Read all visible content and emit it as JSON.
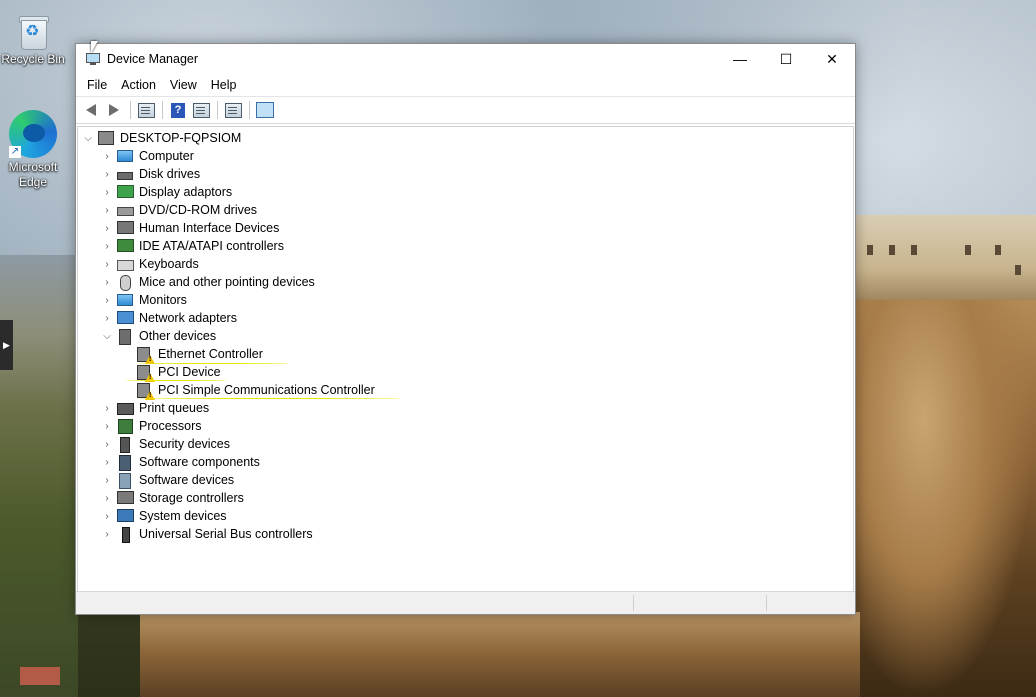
{
  "desktop": {
    "icons": [
      {
        "label": "Recycle Bin",
        "icon": "recycle-bin-icon"
      },
      {
        "label": "Microsoft Edge",
        "icon": "edge-icon"
      }
    ]
  },
  "window": {
    "title": "Device Manager",
    "controls": {
      "minimize": "—",
      "maximize": "☐",
      "close": "✕"
    },
    "menu": [
      "File",
      "Action",
      "View",
      "Help"
    ],
    "toolbar": [
      "back-icon",
      "forward-icon",
      "properties-icon",
      "help-icon",
      "show-hide-icon",
      "update-driver-icon",
      "scan-hardware-icon"
    ]
  },
  "tree": {
    "root": "DESKTOP-FQPSIOM",
    "categories": [
      {
        "label": "Computer",
        "icon": "computer-icon",
        "expanded": false
      },
      {
        "label": "Disk drives",
        "icon": "disk-drive-icon",
        "expanded": false
      },
      {
        "label": "Display adaptors",
        "icon": "display-adapter-icon",
        "expanded": false
      },
      {
        "label": "DVD/CD-ROM drives",
        "icon": "dvd-drive-icon",
        "expanded": false
      },
      {
        "label": "Human Interface Devices",
        "icon": "hid-icon",
        "expanded": false
      },
      {
        "label": "IDE ATA/ATAPI controllers",
        "icon": "ide-controller-icon",
        "expanded": false
      },
      {
        "label": "Keyboards",
        "icon": "keyboard-icon",
        "expanded": false
      },
      {
        "label": "Mice and other pointing devices",
        "icon": "mouse-icon",
        "expanded": false
      },
      {
        "label": "Monitors",
        "icon": "monitor-icon",
        "expanded": false
      },
      {
        "label": "Network adapters",
        "icon": "network-adapter-icon",
        "expanded": false
      },
      {
        "label": "Other devices",
        "icon": "other-devices-icon",
        "expanded": true,
        "children": [
          {
            "label": "Ethernet Controller",
            "icon": "unknown-device-warning-icon"
          },
          {
            "label": "PCI Device",
            "icon": "unknown-device-warning-icon"
          },
          {
            "label": "PCI Simple Communications Controller",
            "icon": "unknown-device-warning-icon"
          }
        ]
      },
      {
        "label": "Print queues",
        "icon": "printer-icon",
        "expanded": false
      },
      {
        "label": "Processors",
        "icon": "processor-icon",
        "expanded": false
      },
      {
        "label": "Security devices",
        "icon": "security-device-icon",
        "expanded": false
      },
      {
        "label": "Software components",
        "icon": "software-component-icon",
        "expanded": false
      },
      {
        "label": "Software devices",
        "icon": "software-device-icon",
        "expanded": false
      },
      {
        "label": "Storage controllers",
        "icon": "storage-controller-icon",
        "expanded": false
      },
      {
        "label": "System devices",
        "icon": "system-device-icon",
        "expanded": false
      },
      {
        "label": "Universal Serial Bus controllers",
        "icon": "usb-controller-icon",
        "expanded": false
      }
    ]
  },
  "colors": {
    "highlight_annotation": "#e8e800",
    "warning": "#f2c200"
  }
}
